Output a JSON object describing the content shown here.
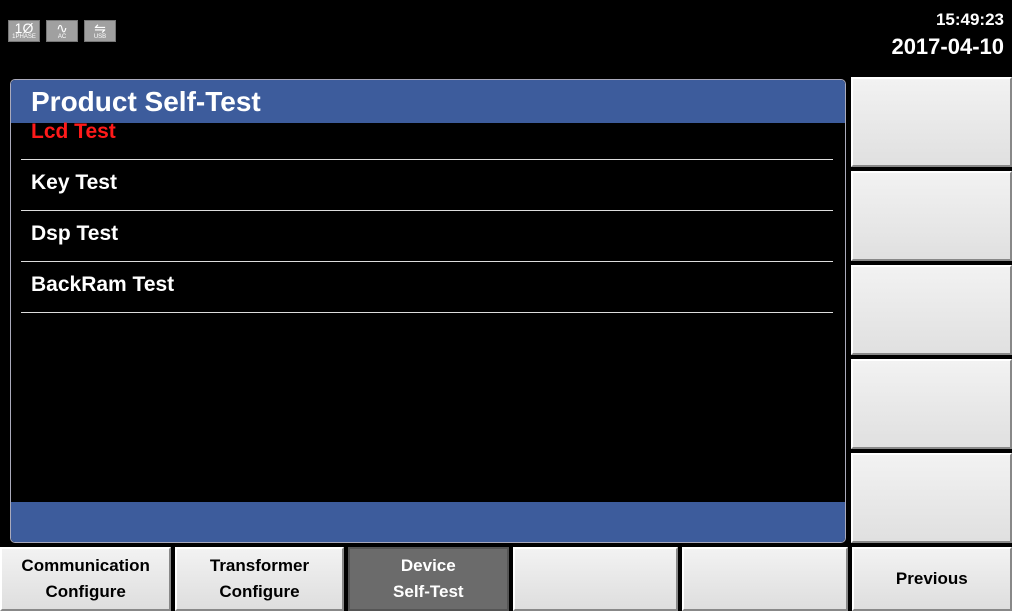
{
  "status_bar": {
    "icons": [
      {
        "name": "phase-icon",
        "glyph": "1Ø",
        "caption": "1PHASE"
      },
      {
        "name": "ac-waveform-icon",
        "glyph": "∿",
        "caption": "AC"
      },
      {
        "name": "usb-icon",
        "glyph": "⇋",
        "caption": "USB"
      }
    ],
    "time": "15:49:23",
    "date": "2017-04-10"
  },
  "panel": {
    "title": "Product Self-Test",
    "items": [
      {
        "label": "Lcd Test",
        "selected": true
      },
      {
        "label": "Key Test",
        "selected": false
      },
      {
        "label": "Dsp Test",
        "selected": false
      },
      {
        "label": "BackRam Test",
        "selected": false
      }
    ]
  },
  "bottom_keys": [
    {
      "line1": "Communication",
      "line2": "Configure"
    },
    {
      "line1": "Transformer",
      "line2": "Configure"
    },
    {
      "line1": "Device",
      "line2": "Self-Test"
    },
    {
      "line1": "",
      "line2": ""
    },
    {
      "line1": "",
      "line2": ""
    },
    {
      "line1": "Previous",
      "line2": ""
    }
  ],
  "colors": {
    "header_bg": "#3d5c9c",
    "selected_text": "#ff1a1a",
    "active_key_bg": "#6b6b6b"
  }
}
